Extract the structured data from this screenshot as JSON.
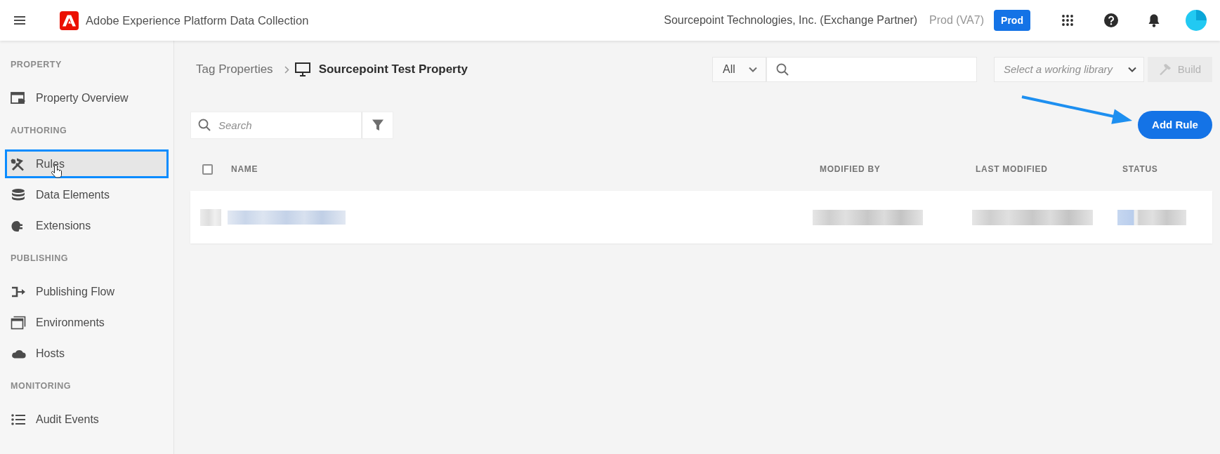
{
  "top_bar": {
    "app_title": "Adobe Experience Platform Data Collection",
    "organization": "Sourcepoint Technologies, Inc. (Exchange Partner)",
    "environment_label": "Prod (VA7)",
    "environment_button": "Prod"
  },
  "sidebar": {
    "sections": [
      {
        "heading": "PROPERTY",
        "items": [
          {
            "label": "Property Overview",
            "selected": false,
            "hovered": false,
            "highlighted": false
          }
        ]
      },
      {
        "heading": "AUTHORING",
        "items": [
          {
            "label": "Rules",
            "selected": true,
            "hovered": true,
            "highlighted": true
          },
          {
            "label": "Data Elements",
            "selected": false,
            "hovered": false,
            "highlighted": false
          },
          {
            "label": "Extensions",
            "selected": false,
            "hovered": false,
            "highlighted": false
          }
        ]
      },
      {
        "heading": "PUBLISHING",
        "items": [
          {
            "label": "Publishing Flow",
            "selected": false,
            "hovered": false,
            "highlighted": false
          },
          {
            "label": "Environments",
            "selected": false,
            "hovered": false,
            "highlighted": false
          },
          {
            "label": "Hosts",
            "selected": false,
            "hovered": false,
            "highlighted": false
          }
        ]
      },
      {
        "heading": "MONITORING",
        "items": [
          {
            "label": "Audit Events",
            "selected": false,
            "hovered": false,
            "highlighted": false
          }
        ]
      }
    ]
  },
  "breadcrumb": {
    "parent": "Tag Properties",
    "current": "Sourcepoint Test Property"
  },
  "global_search": {
    "scope": "All"
  },
  "library_select": {
    "placeholder": "Select a working library"
  },
  "build_button": {
    "label": "Build",
    "disabled": true
  },
  "rule_search": {
    "placeholder": "Search"
  },
  "add_rule_button": {
    "label": "Add Rule",
    "annotated": true
  },
  "table": {
    "select_all": {
      "checked": false
    },
    "columns": [
      "NAME",
      "MODIFIED BY",
      "LAST MODIFIED",
      "STATUS"
    ],
    "rows": [
      {
        "kind": "blurred"
      }
    ]
  }
}
